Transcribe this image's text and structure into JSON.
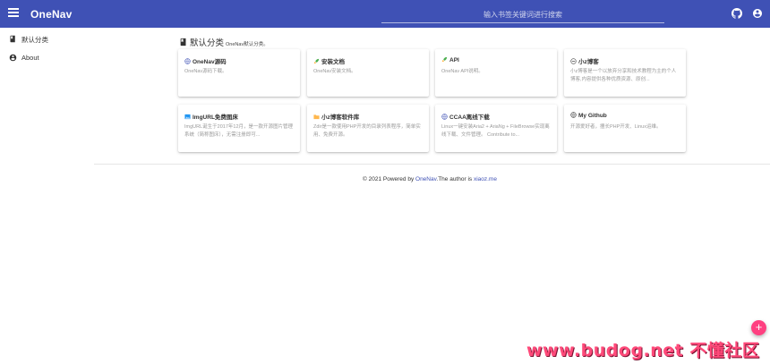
{
  "app": {
    "brand": "OneNav"
  },
  "search": {
    "placeholder": "输入书签关键词进行搜索"
  },
  "sidebar": {
    "items": [
      {
        "label": "默认分类",
        "icon": "book-icon"
      },
      {
        "label": "About",
        "icon": "account-circle-icon"
      }
    ]
  },
  "category": {
    "title": "默认分类",
    "description": "OneNav默认分类。"
  },
  "cards": [
    {
      "title": "OneNav源码",
      "description": "OneNav源码下载。",
      "icon": "globe-icon"
    },
    {
      "title": "安装文档",
      "description": "OneNav安装文档。",
      "icon": "rocket-icon"
    },
    {
      "title": "API",
      "description": "OneNav API说明。",
      "icon": "rocket-icon"
    },
    {
      "title": "小z博客",
      "description": "小z博客是一个以放弃分享和技术教程为主的个人博客,内容提供各种优质资源、原创...",
      "icon": "circle-icon"
    },
    {
      "title": "ImgURL免费图床",
      "description": "ImgURL诞生于2017年12月，是一款开源图片管理系统（简称图床），无需注册即可...",
      "icon": "image-icon"
    },
    {
      "title": "小z博客软件库",
      "description": "Zdir是一款使用PHP开发的目录列表程序，简单实用、免费开源。",
      "icon": "folder-icon"
    },
    {
      "title": "CCAA离线下载",
      "description": "Linux一键安装Aria2 + AriaNg + FileBrowse实现离线下载、文件管理。 Contribute to...",
      "icon": "globe-icon"
    },
    {
      "title": "My Github",
      "description": "开源爱好者，擅长PHP开发、Linux运维。",
      "icon": "globe-icon"
    }
  ],
  "footer": {
    "prefix": "© 2021 Powered by ",
    "link1": "OneNav",
    "middle": ".The author is ",
    "link2": "xiaoz.me"
  },
  "fab": {
    "label": "+"
  },
  "watermark": "www.budog.net 不懂社区",
  "colors": {
    "primary": "#3f51b5",
    "accent": "#ff4081"
  }
}
